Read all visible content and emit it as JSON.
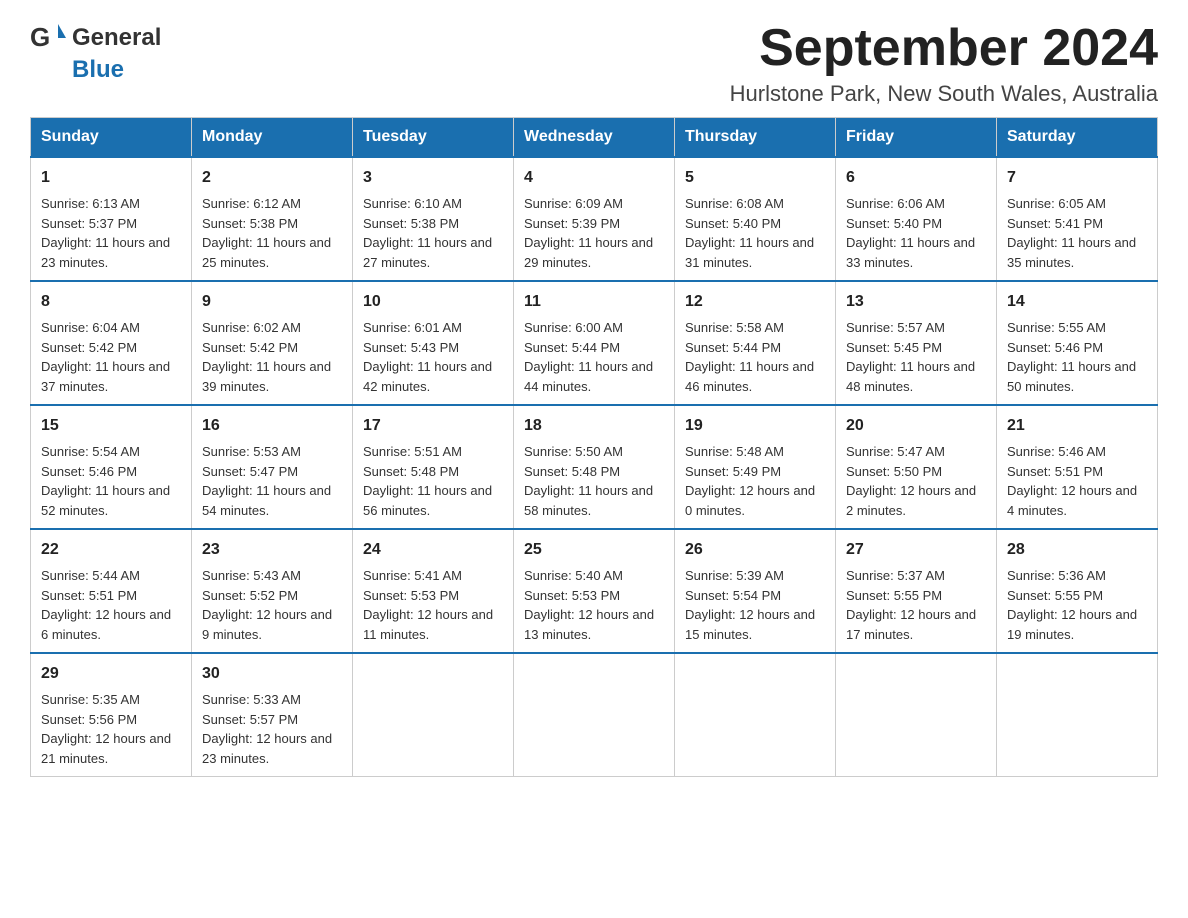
{
  "header": {
    "logo_general": "General",
    "logo_blue": "Blue",
    "month_title": "September 2024",
    "location": "Hurlstone Park, New South Wales, Australia"
  },
  "weekdays": [
    "Sunday",
    "Monday",
    "Tuesday",
    "Wednesday",
    "Thursday",
    "Friday",
    "Saturday"
  ],
  "weeks": [
    [
      {
        "day": "1",
        "sunrise": "6:13 AM",
        "sunset": "5:37 PM",
        "daylight": "11 hours and 23 minutes."
      },
      {
        "day": "2",
        "sunrise": "6:12 AM",
        "sunset": "5:38 PM",
        "daylight": "11 hours and 25 minutes."
      },
      {
        "day": "3",
        "sunrise": "6:10 AM",
        "sunset": "5:38 PM",
        "daylight": "11 hours and 27 minutes."
      },
      {
        "day": "4",
        "sunrise": "6:09 AM",
        "sunset": "5:39 PM",
        "daylight": "11 hours and 29 minutes."
      },
      {
        "day": "5",
        "sunrise": "6:08 AM",
        "sunset": "5:40 PM",
        "daylight": "11 hours and 31 minutes."
      },
      {
        "day": "6",
        "sunrise": "6:06 AM",
        "sunset": "5:40 PM",
        "daylight": "11 hours and 33 minutes."
      },
      {
        "day": "7",
        "sunrise": "6:05 AM",
        "sunset": "5:41 PM",
        "daylight": "11 hours and 35 minutes."
      }
    ],
    [
      {
        "day": "8",
        "sunrise": "6:04 AM",
        "sunset": "5:42 PM",
        "daylight": "11 hours and 37 minutes."
      },
      {
        "day": "9",
        "sunrise": "6:02 AM",
        "sunset": "5:42 PM",
        "daylight": "11 hours and 39 minutes."
      },
      {
        "day": "10",
        "sunrise": "6:01 AM",
        "sunset": "5:43 PM",
        "daylight": "11 hours and 42 minutes."
      },
      {
        "day": "11",
        "sunrise": "6:00 AM",
        "sunset": "5:44 PM",
        "daylight": "11 hours and 44 minutes."
      },
      {
        "day": "12",
        "sunrise": "5:58 AM",
        "sunset": "5:44 PM",
        "daylight": "11 hours and 46 minutes."
      },
      {
        "day": "13",
        "sunrise": "5:57 AM",
        "sunset": "5:45 PM",
        "daylight": "11 hours and 48 minutes."
      },
      {
        "day": "14",
        "sunrise": "5:55 AM",
        "sunset": "5:46 PM",
        "daylight": "11 hours and 50 minutes."
      }
    ],
    [
      {
        "day": "15",
        "sunrise": "5:54 AM",
        "sunset": "5:46 PM",
        "daylight": "11 hours and 52 minutes."
      },
      {
        "day": "16",
        "sunrise": "5:53 AM",
        "sunset": "5:47 PM",
        "daylight": "11 hours and 54 minutes."
      },
      {
        "day": "17",
        "sunrise": "5:51 AM",
        "sunset": "5:48 PM",
        "daylight": "11 hours and 56 minutes."
      },
      {
        "day": "18",
        "sunrise": "5:50 AM",
        "sunset": "5:48 PM",
        "daylight": "11 hours and 58 minutes."
      },
      {
        "day": "19",
        "sunrise": "5:48 AM",
        "sunset": "5:49 PM",
        "daylight": "12 hours and 0 minutes."
      },
      {
        "day": "20",
        "sunrise": "5:47 AM",
        "sunset": "5:50 PM",
        "daylight": "12 hours and 2 minutes."
      },
      {
        "day": "21",
        "sunrise": "5:46 AM",
        "sunset": "5:51 PM",
        "daylight": "12 hours and 4 minutes."
      }
    ],
    [
      {
        "day": "22",
        "sunrise": "5:44 AM",
        "sunset": "5:51 PM",
        "daylight": "12 hours and 6 minutes."
      },
      {
        "day": "23",
        "sunrise": "5:43 AM",
        "sunset": "5:52 PM",
        "daylight": "12 hours and 9 minutes."
      },
      {
        "day": "24",
        "sunrise": "5:41 AM",
        "sunset": "5:53 PM",
        "daylight": "12 hours and 11 minutes."
      },
      {
        "day": "25",
        "sunrise": "5:40 AM",
        "sunset": "5:53 PM",
        "daylight": "12 hours and 13 minutes."
      },
      {
        "day": "26",
        "sunrise": "5:39 AM",
        "sunset": "5:54 PM",
        "daylight": "12 hours and 15 minutes."
      },
      {
        "day": "27",
        "sunrise": "5:37 AM",
        "sunset": "5:55 PM",
        "daylight": "12 hours and 17 minutes."
      },
      {
        "day": "28",
        "sunrise": "5:36 AM",
        "sunset": "5:55 PM",
        "daylight": "12 hours and 19 minutes."
      }
    ],
    [
      {
        "day": "29",
        "sunrise": "5:35 AM",
        "sunset": "5:56 PM",
        "daylight": "12 hours and 21 minutes."
      },
      {
        "day": "30",
        "sunrise": "5:33 AM",
        "sunset": "5:57 PM",
        "daylight": "12 hours and 23 minutes."
      },
      null,
      null,
      null,
      null,
      null
    ]
  ],
  "sunrise_label": "Sunrise:",
  "sunset_label": "Sunset:",
  "daylight_label": "Daylight:"
}
